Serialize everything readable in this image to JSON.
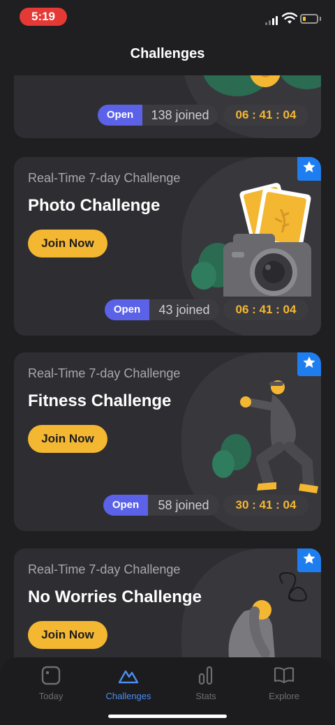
{
  "status_bar": {
    "time": "5:19"
  },
  "nav": {
    "title": "Challenges"
  },
  "top_card": {
    "status": "Open",
    "joined": "138 joined",
    "timer": "06 : 41 : 04"
  },
  "cards": [
    {
      "subtitle": "Real-Time 7-day Challenge",
      "title": "Photo Challenge",
      "button": "Join Now",
      "status": "Open",
      "joined": "43 joined",
      "timer": "06 : 41 : 04",
      "icon": "camera-illustration"
    },
    {
      "subtitle": "Real-Time 7-day Challenge",
      "title": "Fitness Challenge",
      "button": "Join Now",
      "status": "Open",
      "joined": "58 joined",
      "timer": "30 : 41 : 04",
      "icon": "squat-illustration"
    },
    {
      "subtitle": "Real-Time 7-day Challenge",
      "title": "No Worries Challenge",
      "button": "Join Now",
      "icon": "worried-person-illustration"
    }
  ],
  "tabs": [
    {
      "label": "Today",
      "icon": "calendar-icon",
      "active": false
    },
    {
      "label": "Challenges",
      "icon": "mountain-icon",
      "active": true
    },
    {
      "label": "Stats",
      "icon": "stats-icon",
      "active": false
    },
    {
      "label": "Explore",
      "icon": "book-icon",
      "active": false
    }
  ],
  "colors": {
    "background": "#1f1e21",
    "card": "#2e2d31",
    "accent_yellow": "#f4b731",
    "open_blue": "#5b62e8",
    "tab_active": "#4b8ef0",
    "star_badge": "#1e7ef0"
  }
}
